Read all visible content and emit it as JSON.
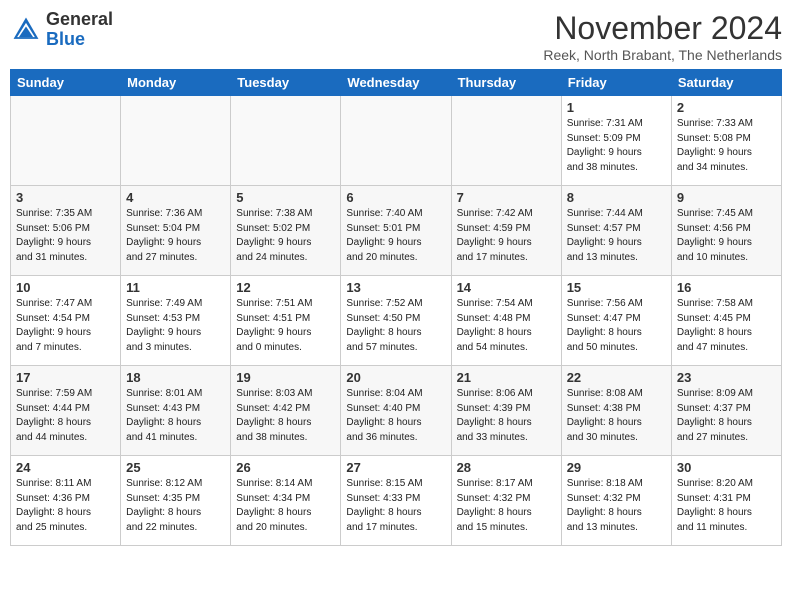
{
  "header": {
    "logo_general": "General",
    "logo_blue": "Blue",
    "month_title": "November 2024",
    "subtitle": "Reek, North Brabant, The Netherlands"
  },
  "weekdays": [
    "Sunday",
    "Monday",
    "Tuesday",
    "Wednesday",
    "Thursday",
    "Friday",
    "Saturday"
  ],
  "weeks": [
    [
      {
        "day": "",
        "info": ""
      },
      {
        "day": "",
        "info": ""
      },
      {
        "day": "",
        "info": ""
      },
      {
        "day": "",
        "info": ""
      },
      {
        "day": "",
        "info": ""
      },
      {
        "day": "1",
        "info": "Sunrise: 7:31 AM\nSunset: 5:09 PM\nDaylight: 9 hours\nand 38 minutes."
      },
      {
        "day": "2",
        "info": "Sunrise: 7:33 AM\nSunset: 5:08 PM\nDaylight: 9 hours\nand 34 minutes."
      }
    ],
    [
      {
        "day": "3",
        "info": "Sunrise: 7:35 AM\nSunset: 5:06 PM\nDaylight: 9 hours\nand 31 minutes."
      },
      {
        "day": "4",
        "info": "Sunrise: 7:36 AM\nSunset: 5:04 PM\nDaylight: 9 hours\nand 27 minutes."
      },
      {
        "day": "5",
        "info": "Sunrise: 7:38 AM\nSunset: 5:02 PM\nDaylight: 9 hours\nand 24 minutes."
      },
      {
        "day": "6",
        "info": "Sunrise: 7:40 AM\nSunset: 5:01 PM\nDaylight: 9 hours\nand 20 minutes."
      },
      {
        "day": "7",
        "info": "Sunrise: 7:42 AM\nSunset: 4:59 PM\nDaylight: 9 hours\nand 17 minutes."
      },
      {
        "day": "8",
        "info": "Sunrise: 7:44 AM\nSunset: 4:57 PM\nDaylight: 9 hours\nand 13 minutes."
      },
      {
        "day": "9",
        "info": "Sunrise: 7:45 AM\nSunset: 4:56 PM\nDaylight: 9 hours\nand 10 minutes."
      }
    ],
    [
      {
        "day": "10",
        "info": "Sunrise: 7:47 AM\nSunset: 4:54 PM\nDaylight: 9 hours\nand 7 minutes."
      },
      {
        "day": "11",
        "info": "Sunrise: 7:49 AM\nSunset: 4:53 PM\nDaylight: 9 hours\nand 3 minutes."
      },
      {
        "day": "12",
        "info": "Sunrise: 7:51 AM\nSunset: 4:51 PM\nDaylight: 9 hours\nand 0 minutes."
      },
      {
        "day": "13",
        "info": "Sunrise: 7:52 AM\nSunset: 4:50 PM\nDaylight: 8 hours\nand 57 minutes."
      },
      {
        "day": "14",
        "info": "Sunrise: 7:54 AM\nSunset: 4:48 PM\nDaylight: 8 hours\nand 54 minutes."
      },
      {
        "day": "15",
        "info": "Sunrise: 7:56 AM\nSunset: 4:47 PM\nDaylight: 8 hours\nand 50 minutes."
      },
      {
        "day": "16",
        "info": "Sunrise: 7:58 AM\nSunset: 4:45 PM\nDaylight: 8 hours\nand 47 minutes."
      }
    ],
    [
      {
        "day": "17",
        "info": "Sunrise: 7:59 AM\nSunset: 4:44 PM\nDaylight: 8 hours\nand 44 minutes."
      },
      {
        "day": "18",
        "info": "Sunrise: 8:01 AM\nSunset: 4:43 PM\nDaylight: 8 hours\nand 41 minutes."
      },
      {
        "day": "19",
        "info": "Sunrise: 8:03 AM\nSunset: 4:42 PM\nDaylight: 8 hours\nand 38 minutes."
      },
      {
        "day": "20",
        "info": "Sunrise: 8:04 AM\nSunset: 4:40 PM\nDaylight: 8 hours\nand 36 minutes."
      },
      {
        "day": "21",
        "info": "Sunrise: 8:06 AM\nSunset: 4:39 PM\nDaylight: 8 hours\nand 33 minutes."
      },
      {
        "day": "22",
        "info": "Sunrise: 8:08 AM\nSunset: 4:38 PM\nDaylight: 8 hours\nand 30 minutes."
      },
      {
        "day": "23",
        "info": "Sunrise: 8:09 AM\nSunset: 4:37 PM\nDaylight: 8 hours\nand 27 minutes."
      }
    ],
    [
      {
        "day": "24",
        "info": "Sunrise: 8:11 AM\nSunset: 4:36 PM\nDaylight: 8 hours\nand 25 minutes."
      },
      {
        "day": "25",
        "info": "Sunrise: 8:12 AM\nSunset: 4:35 PM\nDaylight: 8 hours\nand 22 minutes."
      },
      {
        "day": "26",
        "info": "Sunrise: 8:14 AM\nSunset: 4:34 PM\nDaylight: 8 hours\nand 20 minutes."
      },
      {
        "day": "27",
        "info": "Sunrise: 8:15 AM\nSunset: 4:33 PM\nDaylight: 8 hours\nand 17 minutes."
      },
      {
        "day": "28",
        "info": "Sunrise: 8:17 AM\nSunset: 4:32 PM\nDaylight: 8 hours\nand 15 minutes."
      },
      {
        "day": "29",
        "info": "Sunrise: 8:18 AM\nSunset: 4:32 PM\nDaylight: 8 hours\nand 13 minutes."
      },
      {
        "day": "30",
        "info": "Sunrise: 8:20 AM\nSunset: 4:31 PM\nDaylight: 8 hours\nand 11 minutes."
      }
    ]
  ]
}
